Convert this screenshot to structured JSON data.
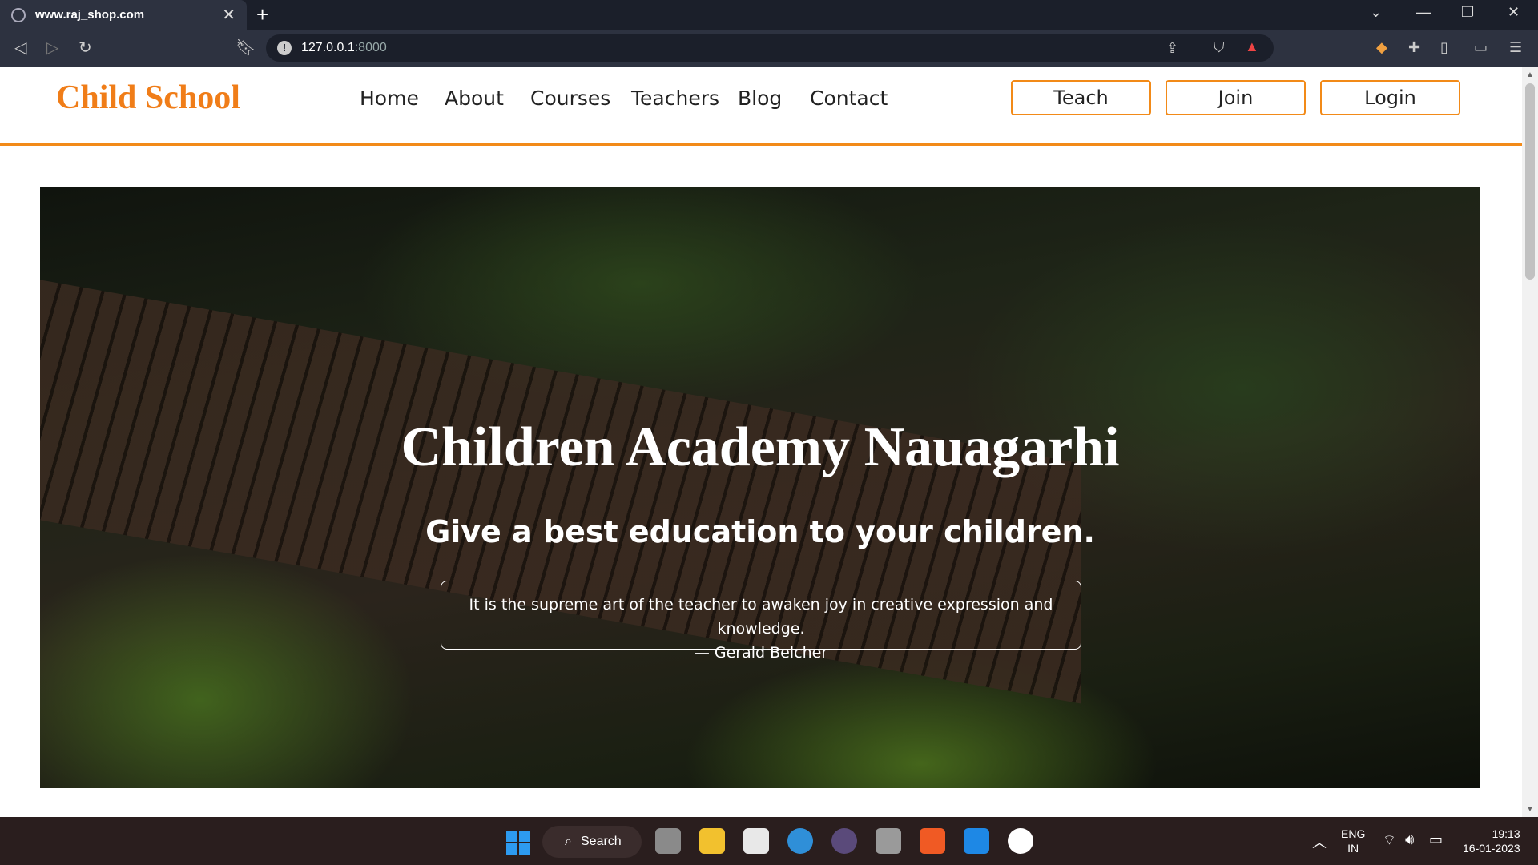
{
  "browser": {
    "tab_title": "www.raj_shop.com",
    "new_tab_symbol": "+",
    "url_host": "127.0.0.1",
    "url_port": ":8000"
  },
  "site": {
    "brand": "Child School",
    "nav": [
      "Home",
      "About",
      "Courses",
      "Teachers",
      "Blog",
      "Contact"
    ],
    "auth_buttons": [
      "Teach",
      "Join",
      "Login"
    ],
    "accent_color": "#f28a18"
  },
  "hero": {
    "title": "Children Academy Nauagarhi",
    "subtitle": "Give a best education to your children.",
    "quote": "It is the supreme art of the teacher to awaken joy in creative expression and knowledge.",
    "quote_author": "— Gerald Belcher"
  },
  "taskbar": {
    "search_label": "Search",
    "lang_primary": "ENG",
    "lang_secondary": "IN",
    "time": "19:13",
    "date": "16-01-2023"
  }
}
